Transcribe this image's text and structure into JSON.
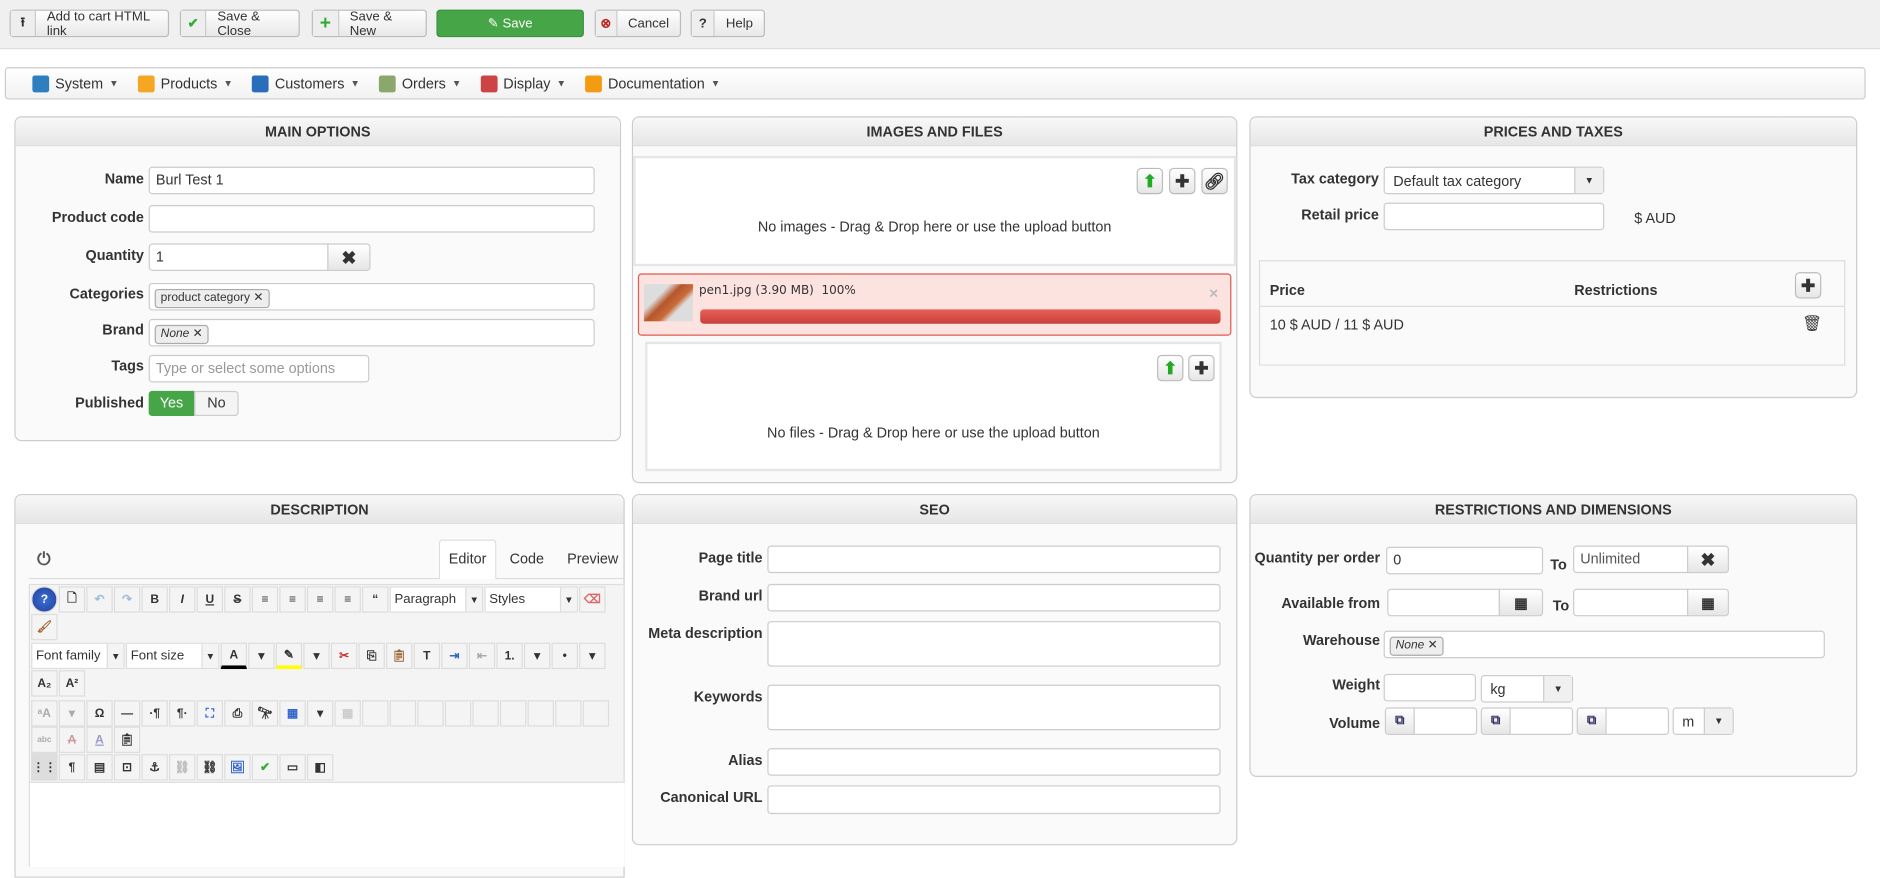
{
  "toolbar": {
    "add_cart": "Add to cart HTML link",
    "save_close": "Save & Close",
    "save_new": "Save & New",
    "save": "Save",
    "cancel": "Cancel",
    "help": "Help"
  },
  "menu": [
    {
      "label": "System",
      "color": "#2f7fc0"
    },
    {
      "label": "Products",
      "color": "#f5a623"
    },
    {
      "label": "Customers",
      "color": "#2a6ebb"
    },
    {
      "label": "Orders",
      "color": "#8aa86c"
    },
    {
      "label": "Display",
      "color": "#c44"
    },
    {
      "label": "Documentation",
      "color": "#f39c12"
    }
  ],
  "main": {
    "title": "MAIN OPTIONS",
    "name_label": "Name",
    "name": "Burl Test 1",
    "code_label": "Product code",
    "qty_label": "Quantity",
    "qty": "1",
    "cat_label": "Categories",
    "cat_tag": "product category",
    "brand_label": "Brand",
    "brand_tag": "None",
    "tags_label": "Tags",
    "tags_placeholder": "Type or select some options",
    "pub_label": "Published",
    "yes": "Yes",
    "no": "No"
  },
  "images": {
    "title": "IMAGES AND FILES",
    "no_images": "No images - Drag & Drop here or use the upload button",
    "upload_name": "pen1.jpg (3.90 MB)",
    "upload_pct": "100%",
    "progress": 100,
    "no_files": "No files - Drag & Drop here or use the upload button"
  },
  "prices": {
    "title": "PRICES AND TAXES",
    "tax_label": "Tax category",
    "tax_value": "Default tax category",
    "retail_label": "Retail price",
    "currency": "$ AUD",
    "col_price": "Price",
    "col_restr": "Restrictions",
    "row_price": "10 $ AUD / 11 $ AUD"
  },
  "desc": {
    "title": "DESCRIPTION",
    "tab_editor": "Editor",
    "tab_code": "Code",
    "tab_preview": "Preview",
    "paragraph": "Paragraph",
    "styles": "Styles",
    "font_family": "Font family",
    "font_size": "Font size"
  },
  "seo": {
    "title": "SEO",
    "page_title": "Page title",
    "brand_url": "Brand url",
    "meta": "Meta description",
    "keywords": "Keywords",
    "alias": "Alias",
    "canonical": "Canonical URL"
  },
  "restr": {
    "title": "RESTRICTIONS AND DIMENSIONS",
    "qty_label": "Quantity per order",
    "qty_min": "0",
    "to": "To",
    "qty_max": "Unlimited",
    "avail_label": "Available from",
    "warehouse_label": "Warehouse",
    "warehouse_tag": "None",
    "weight_label": "Weight",
    "weight_unit": "kg",
    "volume_label": "Volume",
    "volume_unit": "m"
  }
}
